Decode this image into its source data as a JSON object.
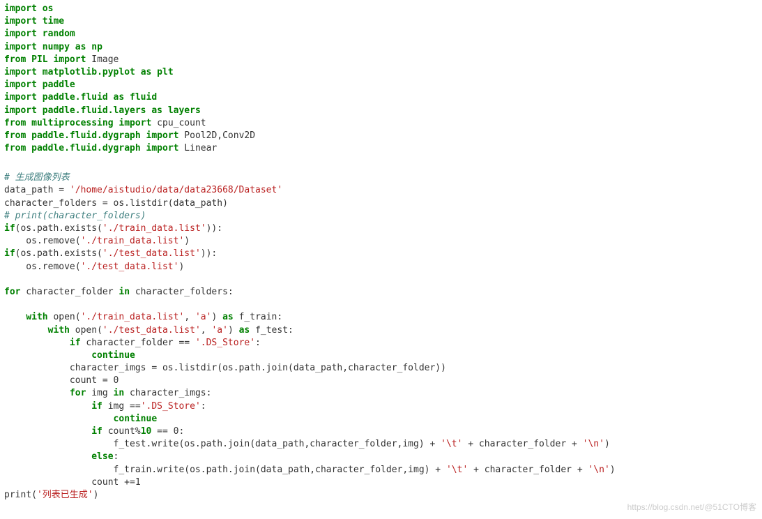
{
  "block1": {
    "lines": [
      [
        {
          "t": "import",
          "c": "kw-green"
        },
        {
          "t": " "
        },
        {
          "t": "os",
          "c": "kw-green"
        }
      ],
      [
        {
          "t": "import",
          "c": "kw-green"
        },
        {
          "t": " "
        },
        {
          "t": "time",
          "c": "kw-green"
        }
      ],
      [
        {
          "t": "import",
          "c": "kw-green"
        },
        {
          "t": " "
        },
        {
          "t": "random",
          "c": "kw-green"
        }
      ],
      [
        {
          "t": "import",
          "c": "kw-green"
        },
        {
          "t": " "
        },
        {
          "t": "numpy",
          "c": "kw-green"
        },
        {
          "t": " "
        },
        {
          "t": "as",
          "c": "kw-green"
        },
        {
          "t": " "
        },
        {
          "t": "np",
          "c": "kw-green"
        }
      ],
      [
        {
          "t": "from",
          "c": "kw-green"
        },
        {
          "t": " "
        },
        {
          "t": "PIL",
          "c": "kw-green"
        },
        {
          "t": " "
        },
        {
          "t": "import",
          "c": "kw-green"
        },
        {
          "t": " Image"
        }
      ],
      [
        {
          "t": "import",
          "c": "kw-green"
        },
        {
          "t": " "
        },
        {
          "t": "matplotlib.pyplot",
          "c": "kw-green"
        },
        {
          "t": " "
        },
        {
          "t": "as",
          "c": "kw-green"
        },
        {
          "t": " "
        },
        {
          "t": "plt",
          "c": "kw-green"
        }
      ],
      [
        {
          "t": "import",
          "c": "kw-green"
        },
        {
          "t": " "
        },
        {
          "t": "paddle",
          "c": "kw-green"
        }
      ],
      [
        {
          "t": "import",
          "c": "kw-green"
        },
        {
          "t": " "
        },
        {
          "t": "paddle.fluid",
          "c": "kw-green"
        },
        {
          "t": " "
        },
        {
          "t": "as",
          "c": "kw-green"
        },
        {
          "t": " "
        },
        {
          "t": "fluid",
          "c": "kw-green"
        }
      ],
      [
        {
          "t": "import",
          "c": "kw-green"
        },
        {
          "t": " "
        },
        {
          "t": "paddle.fluid.layers",
          "c": "kw-green"
        },
        {
          "t": " "
        },
        {
          "t": "as",
          "c": "kw-green"
        },
        {
          "t": " "
        },
        {
          "t": "layers",
          "c": "kw-green"
        }
      ],
      [
        {
          "t": "from",
          "c": "kw-green"
        },
        {
          "t": " "
        },
        {
          "t": "multiprocessing",
          "c": "kw-green"
        },
        {
          "t": " "
        },
        {
          "t": "import",
          "c": "kw-green"
        },
        {
          "t": " cpu_count"
        }
      ],
      [
        {
          "t": "from",
          "c": "kw-green"
        },
        {
          "t": " "
        },
        {
          "t": "paddle.fluid.dygraph",
          "c": "kw-green"
        },
        {
          "t": " "
        },
        {
          "t": "import",
          "c": "kw-green"
        },
        {
          "t": " Pool2D,Conv2D"
        }
      ],
      [
        {
          "t": "from",
          "c": "kw-green"
        },
        {
          "t": " "
        },
        {
          "t": "paddle.fluid.dygraph",
          "c": "kw-green"
        },
        {
          "t": " "
        },
        {
          "t": "import",
          "c": "kw-green"
        },
        {
          "t": " Linear"
        }
      ]
    ]
  },
  "block2": {
    "lines": [
      [
        {
          "t": "# 生成图像列表",
          "c": "comment"
        }
      ],
      [
        {
          "t": "data_path = "
        },
        {
          "t": "'/home/aistudio/data/data23668/Dataset'",
          "c": "str"
        }
      ],
      [
        {
          "t": "character_folders = os.listdir(data_path)"
        }
      ],
      [
        {
          "t": "# print(character_folders)",
          "c": "comment"
        }
      ],
      [
        {
          "t": "if",
          "c": "kw-green"
        },
        {
          "t": "(os.path.exists("
        },
        {
          "t": "'./train_data.list'",
          "c": "str"
        },
        {
          "t": ")):"
        }
      ],
      [
        {
          "t": "    os.remove("
        },
        {
          "t": "'./train_data.list'",
          "c": "str"
        },
        {
          "t": ")"
        }
      ],
      [
        {
          "t": "if",
          "c": "kw-green"
        },
        {
          "t": "(os.path.exists("
        },
        {
          "t": "'./test_data.list'",
          "c": "str"
        },
        {
          "t": ")):"
        }
      ],
      [
        {
          "t": "    os.remove("
        },
        {
          "t": "'./test_data.list'",
          "c": "str"
        },
        {
          "t": ")"
        }
      ],
      [
        {
          "t": "    "
        }
      ],
      [
        {
          "t": "for",
          "c": "kw-green"
        },
        {
          "t": " character_folder "
        },
        {
          "t": "in",
          "c": "kw-green"
        },
        {
          "t": " character_folders:"
        }
      ],
      [
        {
          "t": "    "
        }
      ],
      [
        {
          "t": "    "
        },
        {
          "t": "with",
          "c": "kw-green"
        },
        {
          "t": " open("
        },
        {
          "t": "'./train_data.list'",
          "c": "str"
        },
        {
          "t": ", "
        },
        {
          "t": "'a'",
          "c": "str"
        },
        {
          "t": ") "
        },
        {
          "t": "as",
          "c": "kw-green"
        },
        {
          "t": " f_train:"
        }
      ],
      [
        {
          "t": "        "
        },
        {
          "t": "with",
          "c": "kw-green"
        },
        {
          "t": " open("
        },
        {
          "t": "'./test_data.list'",
          "c": "str"
        },
        {
          "t": ", "
        },
        {
          "t": "'a'",
          "c": "str"
        },
        {
          "t": ") "
        },
        {
          "t": "as",
          "c": "kw-green"
        },
        {
          "t": " f_test:"
        }
      ],
      [
        {
          "t": "            "
        },
        {
          "t": "if",
          "c": "kw-green"
        },
        {
          "t": " character_folder == "
        },
        {
          "t": "'.DS_Store'",
          "c": "str"
        },
        {
          "t": ":"
        }
      ],
      [
        {
          "t": "                "
        },
        {
          "t": "continue",
          "c": "kw-green"
        }
      ],
      [
        {
          "t": "            character_imgs = os.listdir(os.path.join(data_path,character_folder))"
        }
      ],
      [
        {
          "t": "            count = 0"
        }
      ],
      [
        {
          "t": "            "
        },
        {
          "t": "for",
          "c": "kw-green"
        },
        {
          "t": " img "
        },
        {
          "t": "in",
          "c": "kw-green"
        },
        {
          "t": " character_imgs:"
        }
      ],
      [
        {
          "t": "                "
        },
        {
          "t": "if",
          "c": "kw-green"
        },
        {
          "t": " img =="
        },
        {
          "t": "'.DS_Store'",
          "c": "str"
        },
        {
          "t": ":"
        }
      ],
      [
        {
          "t": "                    "
        },
        {
          "t": "continue",
          "c": "kw-green"
        }
      ],
      [
        {
          "t": "                "
        },
        {
          "t": "if",
          "c": "kw-green"
        },
        {
          "t": " count%"
        },
        {
          "t": "10",
          "c": "kw-green"
        },
        {
          "t": " == 0:"
        }
      ],
      [
        {
          "t": "                    f_test.write(os.path.join(data_path,character_folder,img) + "
        },
        {
          "t": "'",
          "c": "str"
        },
        {
          "t": "\\t",
          "c": "str"
        },
        {
          "t": "'",
          "c": "str"
        },
        {
          "t": " + character_folder + "
        },
        {
          "t": "'",
          "c": "str"
        },
        {
          "t": "\\n",
          "c": "str"
        },
        {
          "t": "'",
          "c": "str"
        },
        {
          "t": ")"
        }
      ],
      [
        {
          "t": "                "
        },
        {
          "t": "else",
          "c": "kw-green"
        },
        {
          "t": ":"
        }
      ],
      [
        {
          "t": "                    f_train.write(os.path.join(data_path,character_folder,img) + "
        },
        {
          "t": "'",
          "c": "str"
        },
        {
          "t": "\\t",
          "c": "str"
        },
        {
          "t": "'",
          "c": "str"
        },
        {
          "t": " + character_folder + "
        },
        {
          "t": "'",
          "c": "str"
        },
        {
          "t": "\\n",
          "c": "str"
        },
        {
          "t": "'",
          "c": "str"
        },
        {
          "t": ")"
        }
      ],
      [
        {
          "t": "                count +=1"
        }
      ],
      [
        {
          "t": "print("
        },
        {
          "t": "'列表已生成'",
          "c": "str"
        },
        {
          "t": ")"
        }
      ]
    ]
  },
  "watermark": "https://blog.csdn.net/@51CTO博客"
}
